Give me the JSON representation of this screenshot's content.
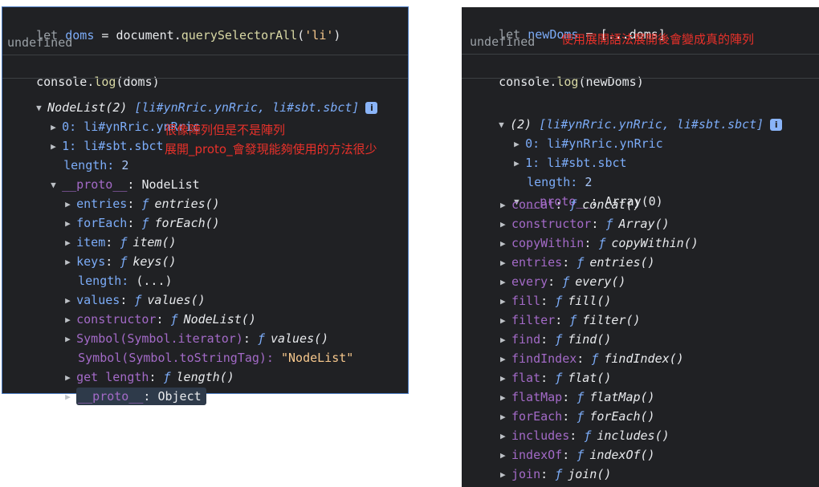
{
  "left": {
    "line1": {
      "kw": "let",
      "var": "doms",
      "eq": "=",
      "obj": "document.",
      "method": "querySelectorAll",
      "open": "(",
      "arg": "'li'",
      "close": ")"
    },
    "undefined_1": "undefined",
    "line3": {
      "fn": "console.",
      "method": "log",
      "args": "(doms)"
    },
    "nodelist_header": {
      "label": "NodeList(2)",
      "items": "[li#ynRric.ynRric, li#sbt.sbct]",
      "badge": "i"
    },
    "item0": {
      "key": "0:",
      "value": "li#ynRric.ynRric"
    },
    "item1": {
      "key": "1:",
      "value": "li#sbt.sbct"
    },
    "length": {
      "key": "length:",
      "value": "2"
    },
    "proto": {
      "key": "__proto__",
      "value": ": NodeList"
    },
    "methods": [
      {
        "key": "entries",
        "fn": "entries()"
      },
      {
        "key": "forEach",
        "fn": "forEach()"
      },
      {
        "key": "item",
        "fn": "item()"
      },
      {
        "key": "keys",
        "fn": "keys()"
      }
    ],
    "length_getter": {
      "key": "length:",
      "value": "(...)"
    },
    "values": {
      "key": "values",
      "fn": "values()"
    },
    "constructor": {
      "key": "constructor",
      "fn": "NodeList()"
    },
    "symbol_iterator": {
      "key": "Symbol(Symbol.iterator)",
      "fn": "values()"
    },
    "symbol_tag": {
      "key": "Symbol(Symbol.toStringTag):",
      "value": "\"NodeList\""
    },
    "get_length": {
      "key": "get length",
      "fn": "length()"
    },
    "proto_object": {
      "key": "__proto__",
      "value": ": Object"
    },
    "fsym": "ƒ",
    "note1": "很像陣列但是不是陣列",
    "note2": "展開_proto_會發現能夠使用的方法很少"
  },
  "right": {
    "line1": {
      "kw": "let",
      "var": "newDoms",
      "eq": "=",
      "rest": "[...doms]"
    },
    "undefined_1": "undefined",
    "note": "使用展開語法展開後會變成真的陣列",
    "line3": {
      "fn": "console.",
      "method": "log",
      "args": "(newDoms)"
    },
    "array_header": {
      "label": "(2)",
      "items": "[li#ynRric.ynRric, li#sbt.sbct]",
      "badge": "i"
    },
    "item0": {
      "key": "0:",
      "value": "li#ynRric.ynRric"
    },
    "item1": {
      "key": "1:",
      "value": "li#sbt.sbct"
    },
    "length": {
      "key": "length:",
      "value": "2"
    },
    "proto": {
      "key": "__proto__",
      "value": ": Array(0)"
    },
    "methods": [
      {
        "key": "concat",
        "fn": "concat()"
      },
      {
        "key": "constructor",
        "fn": "Array()"
      },
      {
        "key": "copyWithin",
        "fn": "copyWithin()"
      },
      {
        "key": "entries",
        "fn": "entries()"
      },
      {
        "key": "every",
        "fn": "every()"
      },
      {
        "key": "fill",
        "fn": "fill()"
      },
      {
        "key": "filter",
        "fn": "filter()"
      },
      {
        "key": "find",
        "fn": "find()"
      },
      {
        "key": "findIndex",
        "fn": "findIndex()"
      },
      {
        "key": "flat",
        "fn": "flat()"
      },
      {
        "key": "flatMap",
        "fn": "flatMap()"
      },
      {
        "key": "forEach",
        "fn": "forEach()"
      },
      {
        "key": "includes",
        "fn": "includes()"
      },
      {
        "key": "indexOf",
        "fn": "indexOf()"
      },
      {
        "key": "join",
        "fn": "join()"
      }
    ],
    "fsym": "ƒ"
  },
  "icons": {
    "collapsed": "triangle-right-icon",
    "expanded": "triangle-down-icon",
    "info": "info-badge-icon"
  },
  "colors": {
    "panel_bg": "#202124",
    "annotation_red": "#e8312a",
    "key_purple": "#a36ac7",
    "string_orange": "#f6c78c"
  }
}
